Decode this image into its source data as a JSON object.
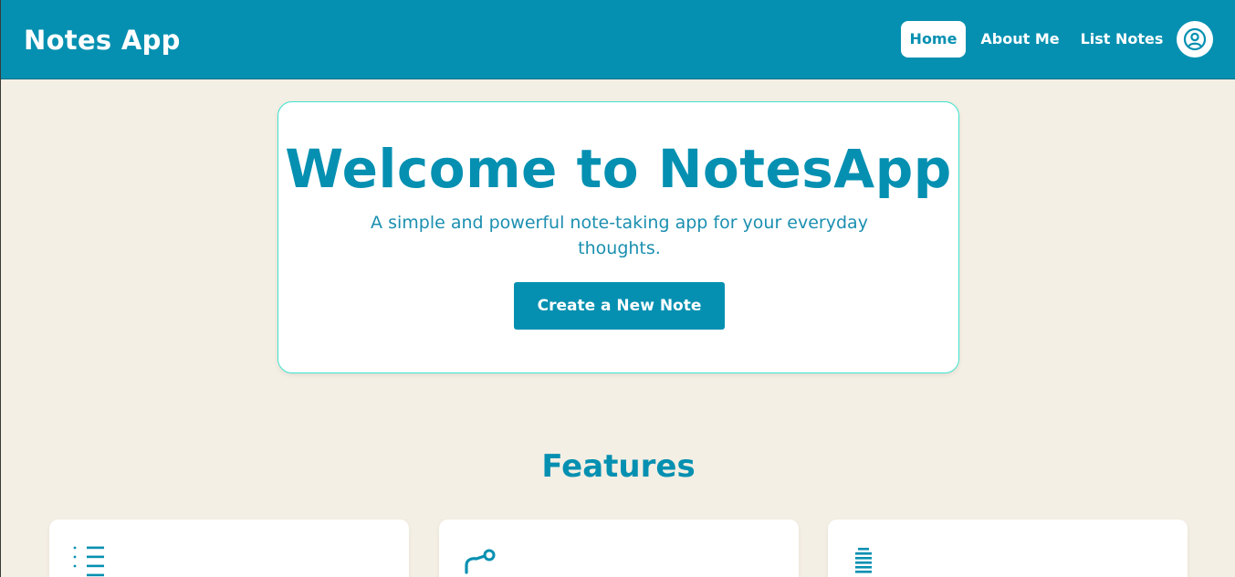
{
  "navbar": {
    "brand": "Notes App",
    "links": [
      {
        "label": "Home",
        "active": true
      },
      {
        "label": "About Me",
        "active": false
      },
      {
        "label": "List Notes",
        "active": false
      }
    ],
    "profile_icon": "user-circle-icon"
  },
  "hero": {
    "title": "Welcome to NotesApp",
    "subtitle": "A simple and powerful note-taking app for your everyday thoughts.",
    "cta_label": "Create a New Note"
  },
  "features": {
    "heading": "Features",
    "cards": [
      {
        "icon": "list-icon"
      },
      {
        "icon": "link-icon"
      },
      {
        "icon": "stack-icon"
      }
    ]
  },
  "colors": {
    "primary": "#0590b1",
    "background": "#f4efe4",
    "hero_border": "#3fe3cf",
    "white": "#ffffff"
  }
}
